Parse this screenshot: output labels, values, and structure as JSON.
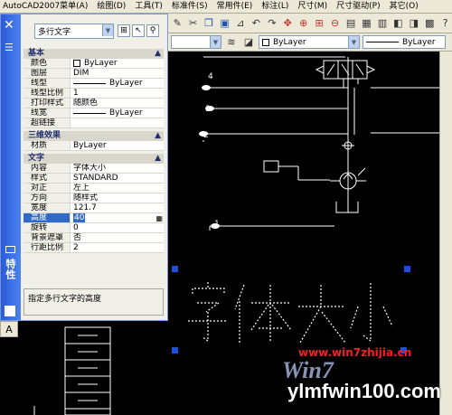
{
  "menubar": {
    "items": [
      "AutoCAD2007菜单(A)",
      "绘图(D)",
      "工具(T)",
      "标准件(S)",
      "常用件(E)",
      "标注(L)",
      "尺寸(M)",
      "尺寸驱动(P)",
      "其它(O)"
    ]
  },
  "layerbar": {
    "color": "ByLayer",
    "linetype": "ByLayer"
  },
  "palette": {
    "title": "特性",
    "object_type": "多行文字",
    "categories": {
      "basic": "基本",
      "three_d": "三维效果",
      "text": "文字"
    },
    "basic_rows": [
      {
        "key": "颜色",
        "value": "ByLayer"
      },
      {
        "key": "图层",
        "value": "DIM"
      },
      {
        "key": "线型",
        "value": "ByLayer"
      },
      {
        "key": "线型比例",
        "value": "1"
      },
      {
        "key": "打印样式",
        "value": "随颜色"
      },
      {
        "key": "线宽",
        "value": "ByLayer"
      },
      {
        "key": "超链接",
        "value": ""
      }
    ],
    "three_d_rows": [
      {
        "key": "材质",
        "value": "ByLayer"
      }
    ],
    "text_rows": [
      {
        "key": "内容",
        "value": "字体大小"
      },
      {
        "key": "样式",
        "value": "STANDARD"
      },
      {
        "key": "对正",
        "value": "左上"
      },
      {
        "key": "方向",
        "value": "随样式"
      },
      {
        "key": "宽度",
        "value": "121.7"
      },
      {
        "key": "高度",
        "value": "40"
      },
      {
        "key": "旋转",
        "value": "0"
      },
      {
        "key": "背景遮罩",
        "value": "否"
      },
      {
        "key": "行距比例",
        "value": "2"
      }
    ],
    "description": "指定多行文字的高度"
  },
  "canvas": {
    "selected_text": "字体大小",
    "labels": [
      "4",
      "3",
      "2",
      "1"
    ],
    "layout_tab": "A"
  },
  "watermarks": {
    "site1": "www.win7zhijia.cn",
    "site2": "ylmfwin100.com",
    "logo": "Win7"
  }
}
